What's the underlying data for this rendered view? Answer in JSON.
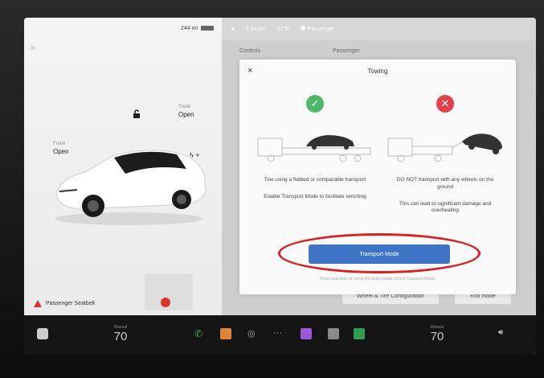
{
  "car_panel": {
    "status_text": "244 mi",
    "frunk": {
      "label": "Frunk",
      "state": "Open"
    },
    "trunk": {
      "label": "Trunk",
      "state": "Open"
    },
    "alert": "Passenger Seatbelt"
  },
  "top_bar": {
    "time": "1:14 pm",
    "temperature": "57°F",
    "profile": "Passenger"
  },
  "sub_row": {
    "controls_label": "Controls",
    "profile_label": "Passenger"
  },
  "behind_buttons": {
    "wheel_tire": "Wheel & Tire Configuration",
    "other": "Roll mode"
  },
  "modal": {
    "title": "Towing",
    "close": "×",
    "left_option": {
      "text1": "Tow using a flatbed or comparable transport",
      "text2": "Enable Transport Mode to facilitate winching"
    },
    "right_option": {
      "text1": "DO NOT transport with any wheels on the ground",
      "text2": "This can lead to significant damage and overheating"
    },
    "button_label": "Transport Mode",
    "footnote": "Press and hold, or press the brake pedal, to exit Transport Mode."
  },
  "dock": {
    "driver_temp_label": "Manual",
    "driver_temp": "70",
    "passenger_temp_label": "Manual",
    "passenger_temp": "70"
  },
  "colors": {
    "accent_blue": "#3f74c4",
    "ok_green": "#4bb86a",
    "no_red": "#e2404a",
    "highlight_red": "#d62222"
  }
}
